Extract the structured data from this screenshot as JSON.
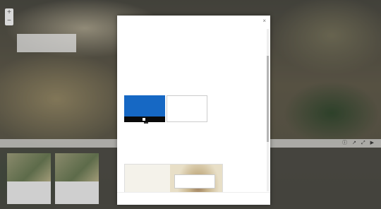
{
  "map": {
    "layer_panel_text": "",
    "bottom_bar_label": "",
    "bottom_icons": [
      "info-icon",
      "share-icon",
      "fullscreen-icon",
      "play-icon"
    ],
    "cards": [
      {
        "label": ""
      },
      {
        "label": ""
      }
    ]
  },
  "modal": {
    "title": "",
    "close_glyph": "×",
    "paragraphs": [
      "",
      "",
      ""
    ],
    "options_label": "",
    "option_a": {
      "label": ""
    },
    "option_b": {
      "label": ""
    },
    "tooltip": "",
    "preview": {
      "heading": "",
      "popup_text": ""
    },
    "footer_button": ""
  }
}
